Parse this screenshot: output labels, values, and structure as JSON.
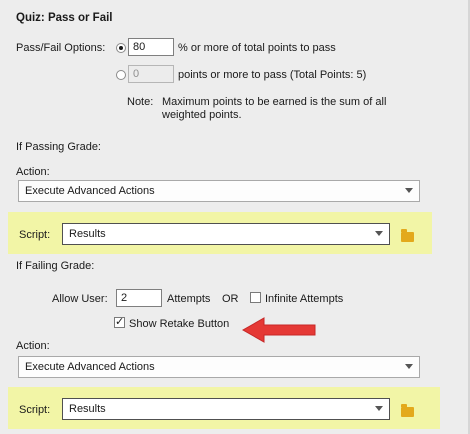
{
  "title": "Quiz: Pass or Fail",
  "pass_fail": {
    "label": "Pass/Fail Options:",
    "percent_value": "80",
    "percent_suffix": "% or more of total points to pass",
    "points_value": "0",
    "points_suffix": "points or more to pass (Total Points: 5)",
    "note_label": "Note:",
    "note_text": "Maximum points to be earned is the sum of all weighted points."
  },
  "passing": {
    "heading": "If Passing Grade:",
    "action_label": "Action:",
    "action_value": "Execute Advanced Actions",
    "script_label": "Script:",
    "script_value": "Results"
  },
  "failing": {
    "heading": "If Failing Grade:",
    "allow_user_label": "Allow User:",
    "attempts_value": "2",
    "attempts_label": "Attempts",
    "or_label": "OR",
    "infinite_label": "Infinite Attempts",
    "show_retake_label": "Show Retake Button",
    "action_label": "Action:",
    "action_value": "Execute Advanced Actions",
    "script_label": "Script:",
    "script_value": "Results"
  },
  "icons": {
    "folder": "folder-icon",
    "arrow": "red-arrow-icon"
  },
  "colors": {
    "highlight": "#f2f5a6",
    "arrow": "#e53935",
    "folder": "#e3a91c"
  }
}
